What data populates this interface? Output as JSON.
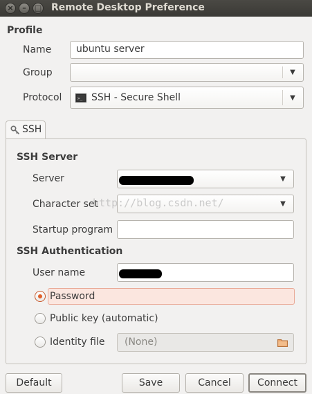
{
  "window": {
    "title": "Remote Desktop Preference"
  },
  "profile": {
    "section_title": "Profile",
    "name_label": "Name",
    "name_value": "ubuntu server",
    "group_label": "Group",
    "group_value": "",
    "protocol_label": "Protocol",
    "protocol_value": "SSH - Secure Shell"
  },
  "tabs": [
    {
      "label": "SSH"
    }
  ],
  "ssh_server": {
    "section_title": "SSH Server",
    "server_label": "Server",
    "charset_label": "Character set",
    "startup_label": "Startup program",
    "startup_value": ""
  },
  "ssh_auth": {
    "section_title": "SSH Authentication",
    "username_label": "User name",
    "options": [
      {
        "label": "Password",
        "selected": true
      },
      {
        "label": "Public key (automatic)",
        "selected": false
      },
      {
        "label": "Identity file",
        "selected": false
      }
    ],
    "identity_file_value": "(None)"
  },
  "watermark": "http://blog.csdn.net/",
  "buttons": {
    "default": "Default",
    "save": "Save",
    "cancel": "Cancel",
    "connect": "Connect"
  },
  "colors": {
    "accent": "#e0602a",
    "highlight_bg": "#fbe6df",
    "titlebar": "#3c3b37"
  }
}
